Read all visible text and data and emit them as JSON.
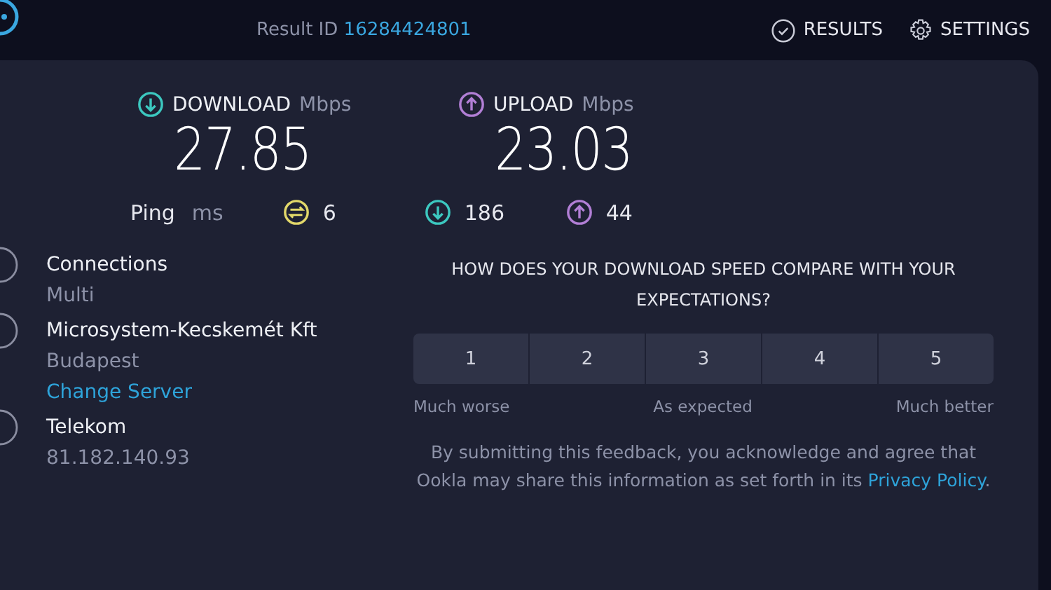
{
  "header": {
    "result_label": "Result ID",
    "result_id": "16284424801",
    "nav": [
      {
        "kind": "results",
        "label": "RESULTS"
      },
      {
        "kind": "settings",
        "label": "SETTINGS"
      }
    ]
  },
  "speeds": [
    {
      "kind": "download",
      "label": "DOWNLOAD",
      "unit": "Mbps",
      "value": "27.85"
    },
    {
      "kind": "upload",
      "label": "UPLOAD",
      "unit": "Mbps",
      "value": "23.03"
    }
  ],
  "ping": {
    "label": "Ping",
    "unit": "ms",
    "readings": [
      {
        "kind": "idle",
        "value": "6"
      },
      {
        "kind": "download",
        "value": "186"
      },
      {
        "kind": "upload",
        "value": "44"
      }
    ]
  },
  "info": [
    {
      "title": "Connections",
      "subtitle": "Multi"
    },
    {
      "title": "Microsystem-Kecskemét Kft",
      "subtitle": "Budapest",
      "link": "Change Server"
    },
    {
      "title": "Telekom",
      "subtitle": "81.182.140.93"
    }
  ],
  "feedback": {
    "question": "HOW DOES YOUR DOWNLOAD SPEED COMPARE WITH YOUR EXPECTATIONS?",
    "ratings": [
      "1",
      "2",
      "3",
      "4",
      "5"
    ],
    "scale_labels": [
      "Much worse",
      "As expected",
      "Much better"
    ],
    "disclaimer": "By submitting this feedback, you acknowledge and agree that Ookla may share this information as set forth in its",
    "privacy_link": "Privacy Policy",
    "disclaimer_end": "."
  }
}
